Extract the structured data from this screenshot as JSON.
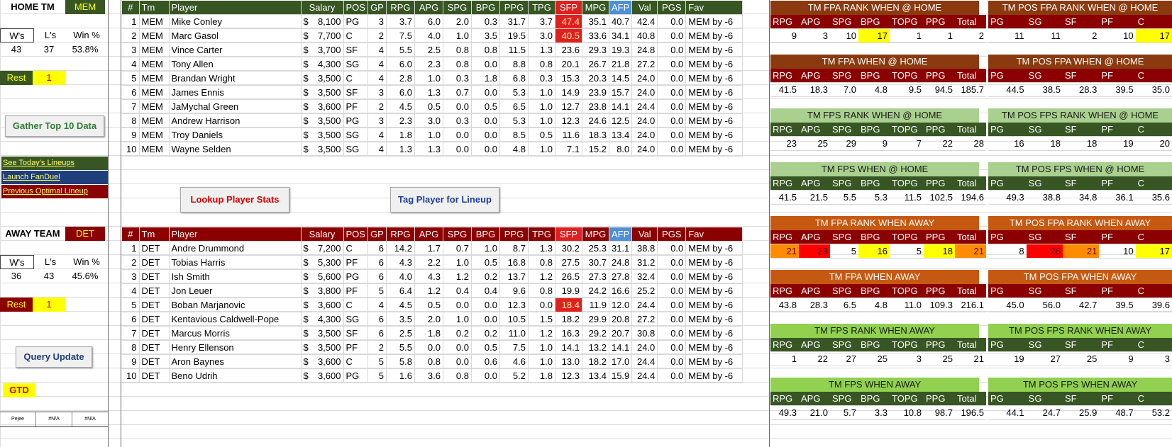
{
  "home": {
    "label": "HOME TM",
    "team": "MEM",
    "record_headers": [
      "W's",
      "L's",
      "Win %"
    ],
    "record_values": [
      "43",
      "37",
      "53.8%"
    ],
    "rest_label": "Rest",
    "rest_value": "1"
  },
  "away": {
    "label": "AWAY TEAM",
    "team": "DET",
    "record_headers": [
      "W's",
      "L's",
      "Win %"
    ],
    "record_values": [
      "36",
      "43",
      "45.6%"
    ],
    "rest_label": "Rest",
    "rest_value": "1"
  },
  "sidebar": {
    "gather_button": "Gather Top 10 Data",
    "links": [
      "See Today's Lineups",
      "Launch FanDuel",
      "Previous Optimal Lineup"
    ],
    "link_colors": [
      "#375623",
      "#1f3f7a",
      "#8b0000"
    ],
    "query_button": "Query Update",
    "gtd_label": "GTD",
    "footer_cells": [
      "Pejee Dayleneer",
      "#N/A",
      "#N/A"
    ]
  },
  "actions": {
    "lookup_button": "Lookup Player Stats",
    "tag_button": "Tag Player for Lineup"
  },
  "columns": [
    "#",
    "Tm",
    "Player",
    "Salary",
    "POS",
    "GP",
    "RPG",
    "APG",
    "SPG",
    "BPG",
    "PPG",
    "TPG",
    "SFP",
    "MPG",
    "AFP",
    "Val",
    "PGS",
    "Fav"
  ],
  "home_players": [
    [
      "1",
      "MEM",
      "Mike Conley",
      "8,100",
      "PG",
      "3",
      "3.7",
      "6.0",
      "2.0",
      "0.3",
      "31.7",
      "3.7",
      "47.4",
      "35.1",
      "40.7",
      "42.4",
      "0.0",
      "MEM by -6"
    ],
    [
      "2",
      "MEM",
      "Marc Gasol",
      "7,700",
      "C",
      "2",
      "7.5",
      "4.0",
      "1.0",
      "3.5",
      "19.5",
      "3.0",
      "40.5",
      "33.6",
      "34.1",
      "40.8",
      "0.0",
      "MEM by -6"
    ],
    [
      "3",
      "MEM",
      "Vince Carter",
      "3,700",
      "SF",
      "4",
      "5.5",
      "2.5",
      "0.8",
      "0.8",
      "11.5",
      "1.3",
      "23.6",
      "29.3",
      "19.3",
      "24.8",
      "0.0",
      "MEM by -6"
    ],
    [
      "4",
      "MEM",
      "Tony Allen",
      "4,300",
      "SG",
      "4",
      "6.0",
      "2.3",
      "0.8",
      "0.0",
      "8.8",
      "0.8",
      "20.1",
      "26.7",
      "21.8",
      "27.2",
      "0.0",
      "MEM by -6"
    ],
    [
      "5",
      "MEM",
      "Brandan Wright",
      "3,500",
      "C",
      "4",
      "2.8",
      "1.0",
      "0.3",
      "1.8",
      "6.8",
      "0.3",
      "15.3",
      "20.3",
      "14.5",
      "24.0",
      "0.0",
      "MEM by -6"
    ],
    [
      "6",
      "MEM",
      "James Ennis",
      "3,500",
      "SF",
      "3",
      "6.0",
      "1.3",
      "0.7",
      "0.0",
      "5.3",
      "1.0",
      "14.9",
      "23.9",
      "15.7",
      "24.0",
      "0.0",
      "MEM by -6"
    ],
    [
      "7",
      "MEM",
      "JaMychal Green",
      "3,600",
      "PF",
      "2",
      "4.5",
      "0.5",
      "0.0",
      "0.5",
      "6.5",
      "1.0",
      "12.7",
      "23.8",
      "14.1",
      "24.4",
      "0.0",
      "MEM by -6"
    ],
    [
      "8",
      "MEM",
      "Andrew Harrison",
      "3,500",
      "PG",
      "3",
      "2.3",
      "3.0",
      "0.3",
      "0.0",
      "5.3",
      "1.0",
      "12.3",
      "24.6",
      "12.5",
      "24.0",
      "0.0",
      "MEM by -6"
    ],
    [
      "9",
      "MEM",
      "Troy Daniels",
      "3,500",
      "SG",
      "4",
      "1.8",
      "1.0",
      "0.0",
      "0.0",
      "8.5",
      "0.5",
      "11.6",
      "18.3",
      "13.4",
      "24.0",
      "0.0",
      "MEM by -6"
    ],
    [
      "10",
      "MEM",
      "Wayne Selden",
      "3,500",
      "SG",
      "4",
      "1.3",
      "1.3",
      "0.0",
      "0.0",
      "4.8",
      "1.0",
      "7.1",
      "15.2",
      "8.0",
      "24.0",
      "0.0",
      "MEM by -6"
    ]
  ],
  "away_players": [
    [
      "1",
      "DET",
      "Andre Drummond",
      "7,200",
      "C",
      "6",
      "14.2",
      "1.7",
      "0.7",
      "1.0",
      "8.7",
      "1.3",
      "30.2",
      "25.3",
      "31.1",
      "38.8",
      "0.0",
      "MEM by -6"
    ],
    [
      "2",
      "DET",
      "Tobias Harris",
      "5,300",
      "PF",
      "6",
      "4.3",
      "2.2",
      "1.0",
      "0.5",
      "16.8",
      "0.8",
      "27.5",
      "30.7",
      "24.8",
      "31.2",
      "0.0",
      "MEM by -6"
    ],
    [
      "3",
      "DET",
      "Ish Smith",
      "5,600",
      "PG",
      "6",
      "4.0",
      "4.3",
      "1.2",
      "0.2",
      "13.7",
      "1.2",
      "26.5",
      "27.3",
      "27.8",
      "32.4",
      "0.0",
      "MEM by -6"
    ],
    [
      "4",
      "DET",
      "Jon Leuer",
      "3,800",
      "PF",
      "5",
      "6.4",
      "1.2",
      "0.4",
      "0.4",
      "9.6",
      "0.8",
      "19.9",
      "24.2",
      "16.6",
      "25.2",
      "0.0",
      "MEM by -6"
    ],
    [
      "5",
      "DET",
      "Boban Marjanovic",
      "3,600",
      "C",
      "4",
      "4.5",
      "0.5",
      "0.0",
      "0.0",
      "12.3",
      "0.0",
      "18.4",
      "11.9",
      "12.0",
      "24.4",
      "0.0",
      "MEM by -6"
    ],
    [
      "6",
      "DET",
      "Kentavious Caldwell-Pope",
      "4,300",
      "SG",
      "6",
      "3.5",
      "2.0",
      "1.0",
      "0.0",
      "10.5",
      "1.5",
      "18.2",
      "29.9",
      "20.8",
      "27.2",
      "0.0",
      "MEM by -6"
    ],
    [
      "7",
      "DET",
      "Marcus Morris",
      "3,500",
      "SF",
      "6",
      "2.5",
      "1.8",
      "0.2",
      "0.2",
      "11.0",
      "1.2",
      "16.3",
      "29.2",
      "20.7",
      "30.8",
      "0.0",
      "MEM by -6"
    ],
    [
      "8",
      "DET",
      "Henry Ellenson",
      "3,500",
      "PF",
      "2",
      "5.5",
      "0.0",
      "0.0",
      "0.5",
      "7.5",
      "1.0",
      "14.1",
      "13.2",
      "14.1",
      "24.0",
      "0.0",
      "MEM by -6"
    ],
    [
      "9",
      "DET",
      "Aron Baynes",
      "3,600",
      "C",
      "5",
      "5.8",
      "0.8",
      "0.0",
      "0.6",
      "4.6",
      "1.0",
      "13.0",
      "18.2",
      "17.0",
      "24.4",
      "0.0",
      "MEM by -6"
    ],
    [
      "10",
      "DET",
      "Beno Udrih",
      "3,600",
      "PG",
      "5",
      "1.6",
      "3.6",
      "0.8",
      "0.0",
      "5.2",
      "1.8",
      "12.3",
      "13.4",
      "15.9",
      "24.4",
      "0.0",
      "MEM by -6"
    ]
  ],
  "panels": {
    "team_cols": [
      "RPG",
      "APG",
      "SPG",
      "BPG",
      "TOPG",
      "PPG",
      "Total"
    ],
    "pos_cols": [
      "PG",
      "SG",
      "SF",
      "PF",
      "C"
    ],
    "home": [
      {
        "team_title": "TM FPA RANK WHEN @ HOME",
        "team_vals": [
          "9",
          "3",
          "10",
          "17",
          "1",
          "1",
          "2"
        ],
        "pos_title": "TM POS FPA RANK WHEN @ HOME",
        "pos_vals": [
          "11",
          "11",
          "2",
          "10",
          "17"
        ],
        "title_color": "#8b3a0f",
        "sub": "red"
      },
      {
        "team_title": "TM FPA WHEN @ HOME",
        "team_vals": [
          "41.5",
          "18.3",
          "7.0",
          "4.8",
          "9.5",
          "94.5",
          "185.7"
        ],
        "pos_title": "TM POS FPA WHEN @ HOME",
        "pos_vals": [
          "44.5",
          "38.5",
          "28.3",
          "39.5",
          "35.0"
        ],
        "title_color": "#8b3a0f",
        "sub": "red"
      },
      {
        "team_title": "TM FPS RANK WHEN @ HOME",
        "team_vals": [
          "23",
          "25",
          "29",
          "9",
          "7",
          "22",
          "28"
        ],
        "pos_title": "TM POS FPS RANK WHEN @ HOME",
        "pos_vals": [
          "16",
          "18",
          "18",
          "19",
          "20"
        ],
        "title_color": "#a9d08e",
        "sub": "green"
      },
      {
        "team_title": "TM FPS WHEN @ HOME",
        "team_vals": [
          "41.5",
          "21.5",
          "5.5",
          "5.3",
          "11.5",
          "102.5",
          "194.6"
        ],
        "pos_title": "TM POS FPS WHEN @ HOME",
        "pos_vals": [
          "49.3",
          "38.8",
          "34.8",
          "36.1",
          "35.6"
        ],
        "title_color": "#a9d08e",
        "sub": "green"
      }
    ],
    "away": [
      {
        "team_title": "TM FPA RANK WHEN AWAY",
        "team_vals": [
          "21",
          "29",
          "5",
          "16",
          "5",
          "18",
          "21"
        ],
        "pos_title": "TM POS FPA RANK WHEN AWAY",
        "pos_vals": [
          "8",
          "26",
          "21",
          "10",
          "17"
        ],
        "title_color": "#c65911",
        "sub": "red"
      },
      {
        "team_title": "TM FPA WHEN AWAY",
        "team_vals": [
          "43.8",
          "28.3",
          "6.5",
          "4.8",
          "11.0",
          "109.3",
          "216.1"
        ],
        "pos_title": "TM POS FPA WHEN AWAY",
        "pos_vals": [
          "45.0",
          "56.0",
          "42.7",
          "39.5",
          "39.6"
        ],
        "title_color": "#c65911",
        "sub": "red"
      },
      {
        "team_title": "TM FPS RANK WHEN AWAY",
        "team_vals": [
          "1",
          "22",
          "27",
          "25",
          "3",
          "25",
          "21"
        ],
        "pos_title": "TM POS FPS RANK WHEN AWAY",
        "pos_vals": [
          "19",
          "27",
          "25",
          "9",
          "3"
        ],
        "title_color": "#92d050",
        "sub": "green"
      },
      {
        "team_title": "TM FPS WHEN AWAY",
        "team_vals": [
          "49.3",
          "21.0",
          "5.7",
          "3.3",
          "10.8",
          "98.7",
          "196.5"
        ],
        "pos_title": "TM POS FPS WHEN AWAY",
        "pos_vals": [
          "44.1",
          "24.7",
          "25.9",
          "48.7",
          "53.2"
        ],
        "title_color": "#92d050",
        "sub": "green"
      }
    ]
  },
  "highlight_colors": {
    "red": "#ff0000",
    "orange": "#ff8c00",
    "yellow": "#ffff00",
    "dark_green": "#375623",
    "dark_red": "#8b0000"
  }
}
